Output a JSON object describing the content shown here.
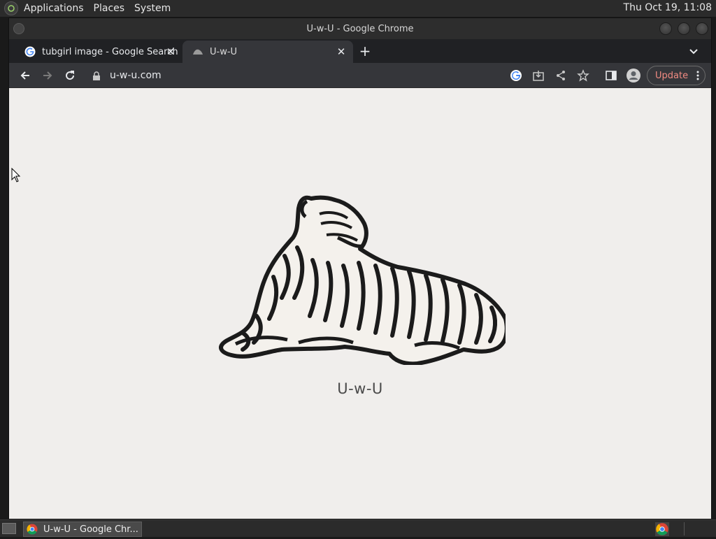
{
  "top_panel": {
    "menus": [
      "Applications",
      "Places",
      "System"
    ],
    "clock": "Thu Oct 19, 11:08"
  },
  "window": {
    "title": "U-w-U - Google Chrome"
  },
  "tabs": [
    {
      "label": "tubgirl image - Google Search",
      "icon": "google-icon",
      "active": false
    },
    {
      "label": "U-w-U",
      "icon": "uwu-site-icon",
      "active": true
    }
  ],
  "toolbar": {
    "url": "u-w-u.com",
    "update_label": "Update"
  },
  "page": {
    "caption": "U-w-U",
    "image": "tiger-illustration"
  },
  "taskbar": {
    "task_label": "U-w-U - Google Chr..."
  },
  "colors": {
    "page_bg": "#f0eeec",
    "tab_active_bg": "#35363a",
    "update_text": "#f28b82"
  }
}
